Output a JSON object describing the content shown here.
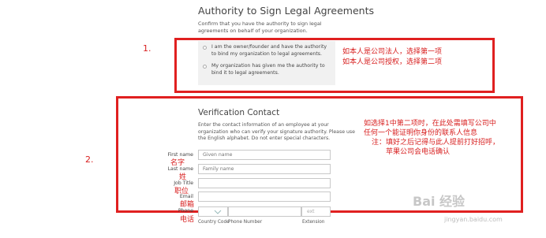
{
  "section1": {
    "title": "Authority to Sign Legal Agreements",
    "description": "Confirm that you have the authority to sign legal agreements on behalf of your organization.",
    "options": [
      {
        "label": "I am the owner/founder and have the authority to bind my organization to legal agreements."
      },
      {
        "label": "My organization has given me the authority to bind it to legal agreements."
      }
    ]
  },
  "annotations": {
    "num1": "1.",
    "num2": "2.",
    "note1_line1": "如本人是公司法人，选择第一项",
    "note1_line2": "如本人是公司授权，选择第二项",
    "note2_line1": "如选择1中第二项时，在此处需填写公司中",
    "note2_line2": "任何一个能证明你身份的联系人信息",
    "note2_line3": "注：填好之后记得与此人提前打好招呼，",
    "note2_line4": "苹果公司会电话确认"
  },
  "section2": {
    "title": "Verification Contact",
    "description": "Enter the contact information of an employee at your organization who can verify your signature authority. Please use the English alphabet. Do not enter special characters.",
    "fields": {
      "first_name": {
        "label": "First name",
        "placeholder": "Given name",
        "zh": "名字"
      },
      "last_name": {
        "label": "Last name",
        "placeholder": "Family name",
        "zh": "姓"
      },
      "job_title": {
        "label": "Job Title",
        "placeholder": "",
        "zh": "职位"
      },
      "email": {
        "label": "Email",
        "placeholder": "",
        "zh": "邮箱"
      },
      "phone": {
        "label": "Phone",
        "zh": "电话",
        "ext_placeholder": "ext",
        "country_code_label": "Country Code",
        "phone_number_label": "Phone Number",
        "extension_label": "Extension"
      }
    }
  },
  "watermark": {
    "brand": "Bai 经验",
    "url": "jingyan.baidu.com"
  },
  "colors": {
    "annotation_red": "#e02020",
    "panel_gray": "#f1f1f1"
  }
}
